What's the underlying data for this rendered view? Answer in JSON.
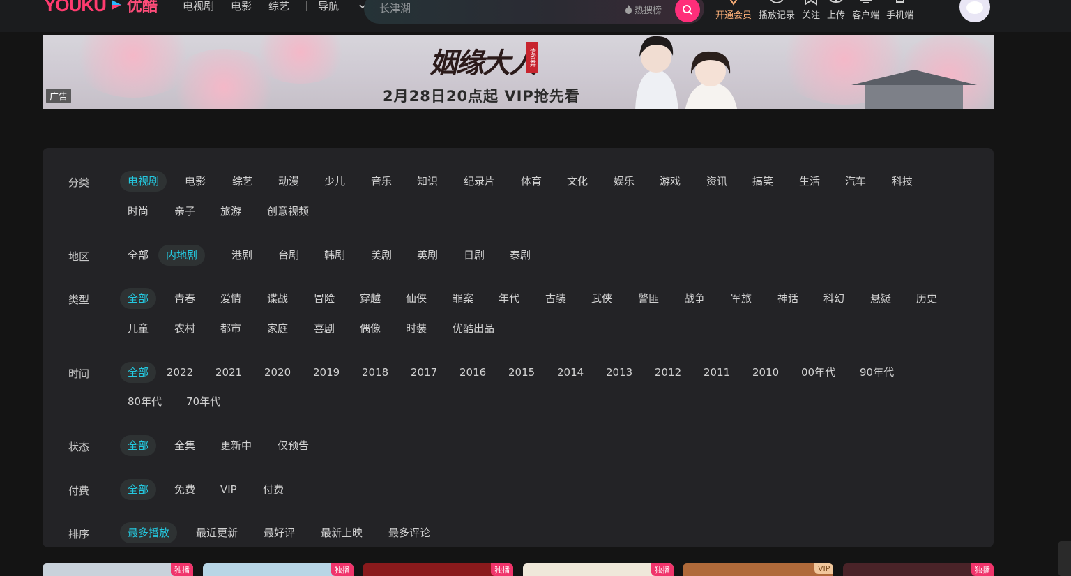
{
  "header": {
    "logo_word": "YOUKU",
    "logo_cn": "优酷",
    "nav": [
      "电视剧",
      "电影",
      "综艺"
    ],
    "nav_menu": "导航",
    "search_placeholder": "长津湖",
    "hot_search": "热搜榜",
    "icons": [
      {
        "name": "vip-icon",
        "label": "开通会员"
      },
      {
        "name": "history-icon",
        "label": "播放记录"
      },
      {
        "name": "follow-icon",
        "label": "关注"
      },
      {
        "name": "upload-icon",
        "label": "上传"
      },
      {
        "name": "desktop-client-icon",
        "label": "客户端"
      },
      {
        "name": "mobile-client-icon",
        "label": "手机端"
      }
    ]
  },
  "banner": {
    "title": "姻缘大人",
    "seal": "清留弃",
    "subtitle": "2月28日20点起 VIP抢先看",
    "ad_tag": "广告"
  },
  "filters": [
    {
      "label": "分类",
      "options": [
        "电视剧",
        "电影",
        "综艺",
        "动漫",
        "少儿",
        "音乐",
        "知识",
        "纪录片",
        "体育",
        "文化",
        "娱乐",
        "游戏",
        "资讯",
        "搞笑",
        "生活",
        "汽车",
        "科技",
        "时尚",
        "亲子",
        "旅游",
        "创意视频"
      ],
      "active": 0
    },
    {
      "label": "地区",
      "options": [
        "全部",
        "内地剧",
        "港剧",
        "台剧",
        "韩剧",
        "美剧",
        "英剧",
        "日剧",
        "泰剧"
      ],
      "active": 1
    },
    {
      "label": "类型",
      "options": [
        "全部",
        "青春",
        "爱情",
        "谍战",
        "冒险",
        "穿越",
        "仙侠",
        "罪案",
        "年代",
        "古装",
        "武侠",
        "警匪",
        "战争",
        "军旅",
        "神话",
        "科幻",
        "悬疑",
        "历史",
        "儿童",
        "农村",
        "都市",
        "家庭",
        "喜剧",
        "偶像",
        "时装",
        "优酷出品"
      ],
      "active": 0
    },
    {
      "label": "时间",
      "options": [
        "全部",
        "2022",
        "2021",
        "2020",
        "2019",
        "2018",
        "2017",
        "2016",
        "2015",
        "2014",
        "2013",
        "2012",
        "2011",
        "2010",
        "00年代",
        "90年代",
        "80年代",
        "70年代"
      ],
      "active": 0
    },
    {
      "label": "状态",
      "options": [
        "全部",
        "全集",
        "更新中",
        "仅预告"
      ],
      "active": 0
    },
    {
      "label": "付费",
      "options": [
        "全部",
        "免费",
        "VIP",
        "付费"
      ],
      "active": 0
    },
    {
      "label": "排序",
      "options": [
        "最多播放",
        "最近更新",
        "最好评",
        "最新上映",
        "最多评论"
      ],
      "active": 0
    }
  ],
  "cards": [
    {
      "badge": "独播",
      "color": "#c9d2db",
      "vip": false
    },
    {
      "badge": "独播",
      "color": "#b8d6e6",
      "vip": false
    },
    {
      "badge": "独播",
      "color": "#8a1a1c",
      "vip": false
    },
    {
      "badge": "独播",
      "color": "#efe8da",
      "vip": false
    },
    {
      "badge": "VIP",
      "color": "#b06a3a",
      "vip": true
    },
    {
      "badge": "独播",
      "color": "#4a2328",
      "vip": false
    }
  ],
  "colors": {
    "accent": "#24c9e0",
    "brand": "#ff2e7a",
    "panel": "#232326",
    "background": "#141414"
  }
}
